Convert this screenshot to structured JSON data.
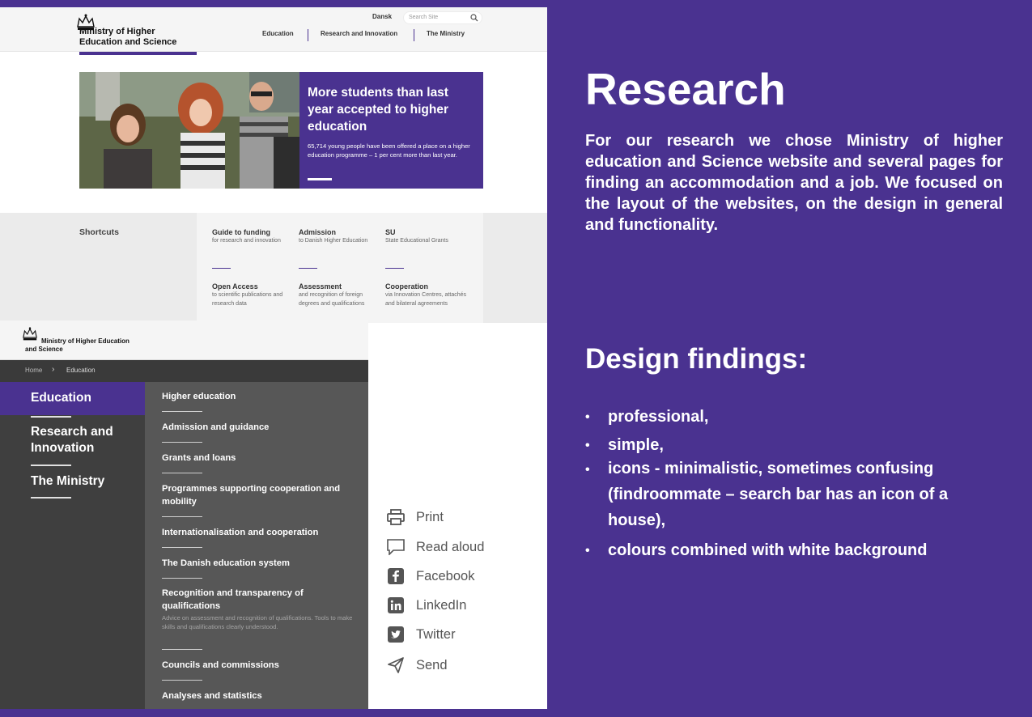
{
  "site": {
    "logo_line1": "Ministry of Higher",
    "logo_line2": "Education and Science",
    "lang": "Dansk",
    "search_placeholder": "Search Site",
    "nav": [
      "Education",
      "Research and Innovation",
      "The Ministry"
    ]
  },
  "hero": {
    "title": "More students than last year accepted to higher education",
    "text": "65,714 young people have been offered a place on a higher education programme – 1 per cent more than last year."
  },
  "shortcuts": {
    "title": "Shortcuts",
    "items": [
      {
        "title": "Guide to funding",
        "sub": "for research and innovation"
      },
      {
        "title": "Admission",
        "sub": "to Danish Higher Education"
      },
      {
        "title": "SU",
        "sub": "State Educational Grants"
      },
      {
        "title": "Open Access",
        "sub": "to scientific publications and research data"
      },
      {
        "title": "Assessment",
        "sub": "and recognition of foreign degrees and qualifications"
      },
      {
        "title": "Cooperation",
        "sub": "via Innovation Centres, attachés and bilateral agreements"
      }
    ]
  },
  "edu": {
    "logo_line1": "Ministry of Higher Education",
    "logo_line2": "and Science",
    "breadcrumb": [
      "Home",
      "Education"
    ],
    "left_nav": [
      "Education",
      "Research and Innovation",
      "The Ministry"
    ],
    "menu": [
      "Higher education",
      "Admission and guidance",
      "Grants and loans",
      "Programmes supporting cooperation and mobility",
      "Internationalisation and cooperation",
      "The Danish education system",
      "Recognition and transparency of qualifications",
      "Councils and commissions",
      "Analyses and statistics"
    ],
    "menu_desc": "Advice on assessment and recognition of qualifications. Tools to make skills and qualifications clearly understood."
  },
  "share": [
    {
      "label": "Print",
      "icon": "print-icon"
    },
    {
      "label": "Read aloud",
      "icon": "speech-bubble-icon"
    },
    {
      "label": "Facebook",
      "icon": "facebook-icon"
    },
    {
      "label": "LinkedIn",
      "icon": "linkedin-icon"
    },
    {
      "label": "Twitter",
      "icon": "twitter-icon"
    },
    {
      "label": "Send",
      "icon": "send-icon"
    }
  ],
  "right": {
    "title": "Research",
    "para": "For our research we chose Ministry of higher education and Science website and several pages for finding an accommodation and a job. We focused on the layout of the websites, on the design in general and functionality.",
    "subtitle": "Design findings:",
    "bullets": [
      "professional,",
      "simple,",
      "icons - minimalistic, sometimes confusing (findroommate – search bar has an icon of a house),",
      "colours combined with white background"
    ]
  },
  "colors": {
    "brand": "#4a3290",
    "dark": "#3f3f3f",
    "mid": "#575757"
  }
}
